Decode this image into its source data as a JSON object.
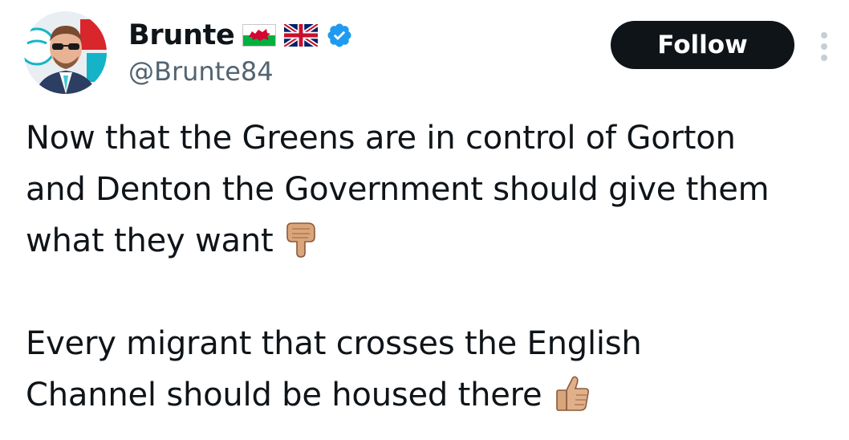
{
  "author": {
    "name": "Brunte",
    "handle": "@Brunte84",
    "badges": [
      "wales-flag-icon",
      "uk-flag-icon",
      "verified-badge-icon"
    ],
    "verified_color": "#1d9bf0"
  },
  "actions": {
    "follow_label": "Follow",
    "more_icon": "more-vertical-icon"
  },
  "tweet": {
    "lines": [
      "Now that the Greens are in control of Gorton",
      "and Denton the Government should give them",
      "what they want",
      "Every migrant that crosses the English",
      "Channel should be housed there"
    ],
    "emojis": [
      "backhand-index-pointing-down-icon",
      "thumbs-up-icon"
    ]
  },
  "colors": {
    "text": "#0f1419",
    "secondary_text": "#536471",
    "button_bg": "#0f1419",
    "button_text": "#ffffff"
  }
}
